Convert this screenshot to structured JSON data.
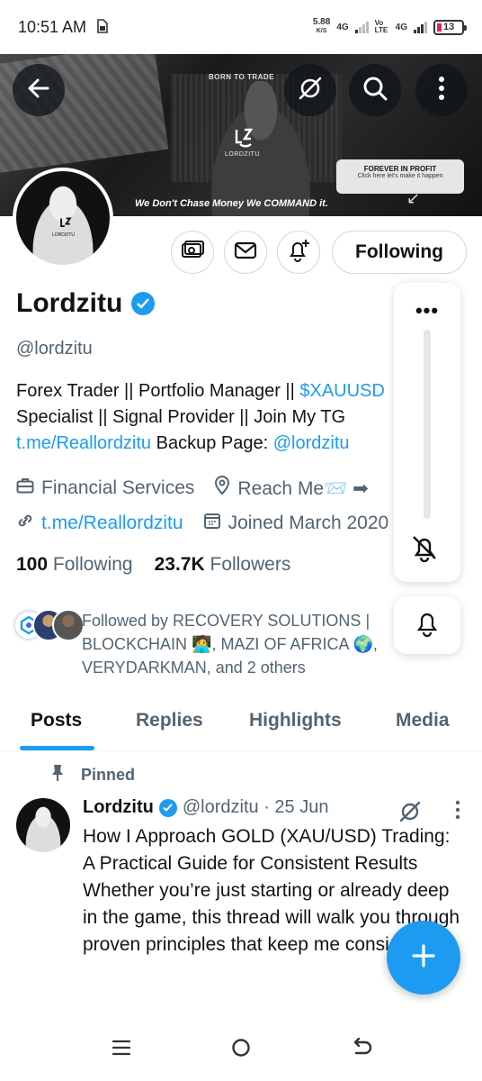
{
  "status_bar": {
    "time": "10:51 AM",
    "sim_icon": "sim-card-icon",
    "net_speed_value": "5.88",
    "net_speed_unit": "K/S",
    "signal1_label": "4G",
    "volte_label": "Vo LTE",
    "signal2_label": "4G",
    "battery_level": "13"
  },
  "header": {
    "back_icon": "arrow-left-icon",
    "grok_icon": "grok-icon",
    "search_icon": "search-icon",
    "more_icon": "more-vertical-icon"
  },
  "banner": {
    "top_text": "BORN TO TRADE",
    "logo_text": "LORDZITU",
    "tagline": "We Don't Chase Money We COMMAND it.",
    "profit_title": "FOREVER IN PROFIT",
    "profit_sub": "Click here let's make it happen"
  },
  "avatar": {
    "logo_text": "LORDZITU"
  },
  "actions": {
    "subscribe_icon": "money-icon",
    "message_icon": "envelope-icon",
    "notify_icon": "bell-plus-icon",
    "following_label": "Following"
  },
  "profile": {
    "name": "Lordzitu",
    "handle": "@lordzitu",
    "bio_line1_text": "Forex Trader || Portfolio Manager || ",
    "bio_line1_link": "$XAUUSD",
    "bio_line2_text": "Specialist || Signal Provider || Join My TG ",
    "bio_line3_link": "t.me/Reallordzitu",
    "bio_line3_text": " Backup Page: ",
    "bio_line3_link2": "@lordzitu",
    "category": "Financial Services",
    "location": "Reach Me📨 ➡",
    "website": "t.me/Reallordzitu",
    "joined": "Joined March 2020",
    "following_count": "100",
    "following_label": "Following",
    "followers_count": "23.7K",
    "followers_label": "Followers",
    "followed_by": "Followed by RECOVERY SOLUTIONS | BLOCKCHAIN 🧑‍💻, MAZI OF AFRICA 🌍, VERYDARKMAN, and 2 others"
  },
  "side_panel": {
    "more_label": "•••"
  },
  "tabs": [
    {
      "label": "Posts"
    },
    {
      "label": "Replies"
    },
    {
      "label": "Highlights"
    },
    {
      "label": "Media"
    }
  ],
  "post": {
    "pinned_label": "Pinned",
    "author_name": "Lordzitu",
    "author_meta": "@lordzitu · 25 Jun",
    "body": "How I Approach GOLD (XAU/USD) Trading: A Practical Guide for Consistent Results\nWhether you’re just starting or already deep in the game, this thread will walk you through proven principles that keep me consistent."
  },
  "colors": {
    "accent": "#1d9bf0",
    "text_primary": "#0f1419",
    "text_secondary": "#536471",
    "border": "#cfd9de"
  }
}
